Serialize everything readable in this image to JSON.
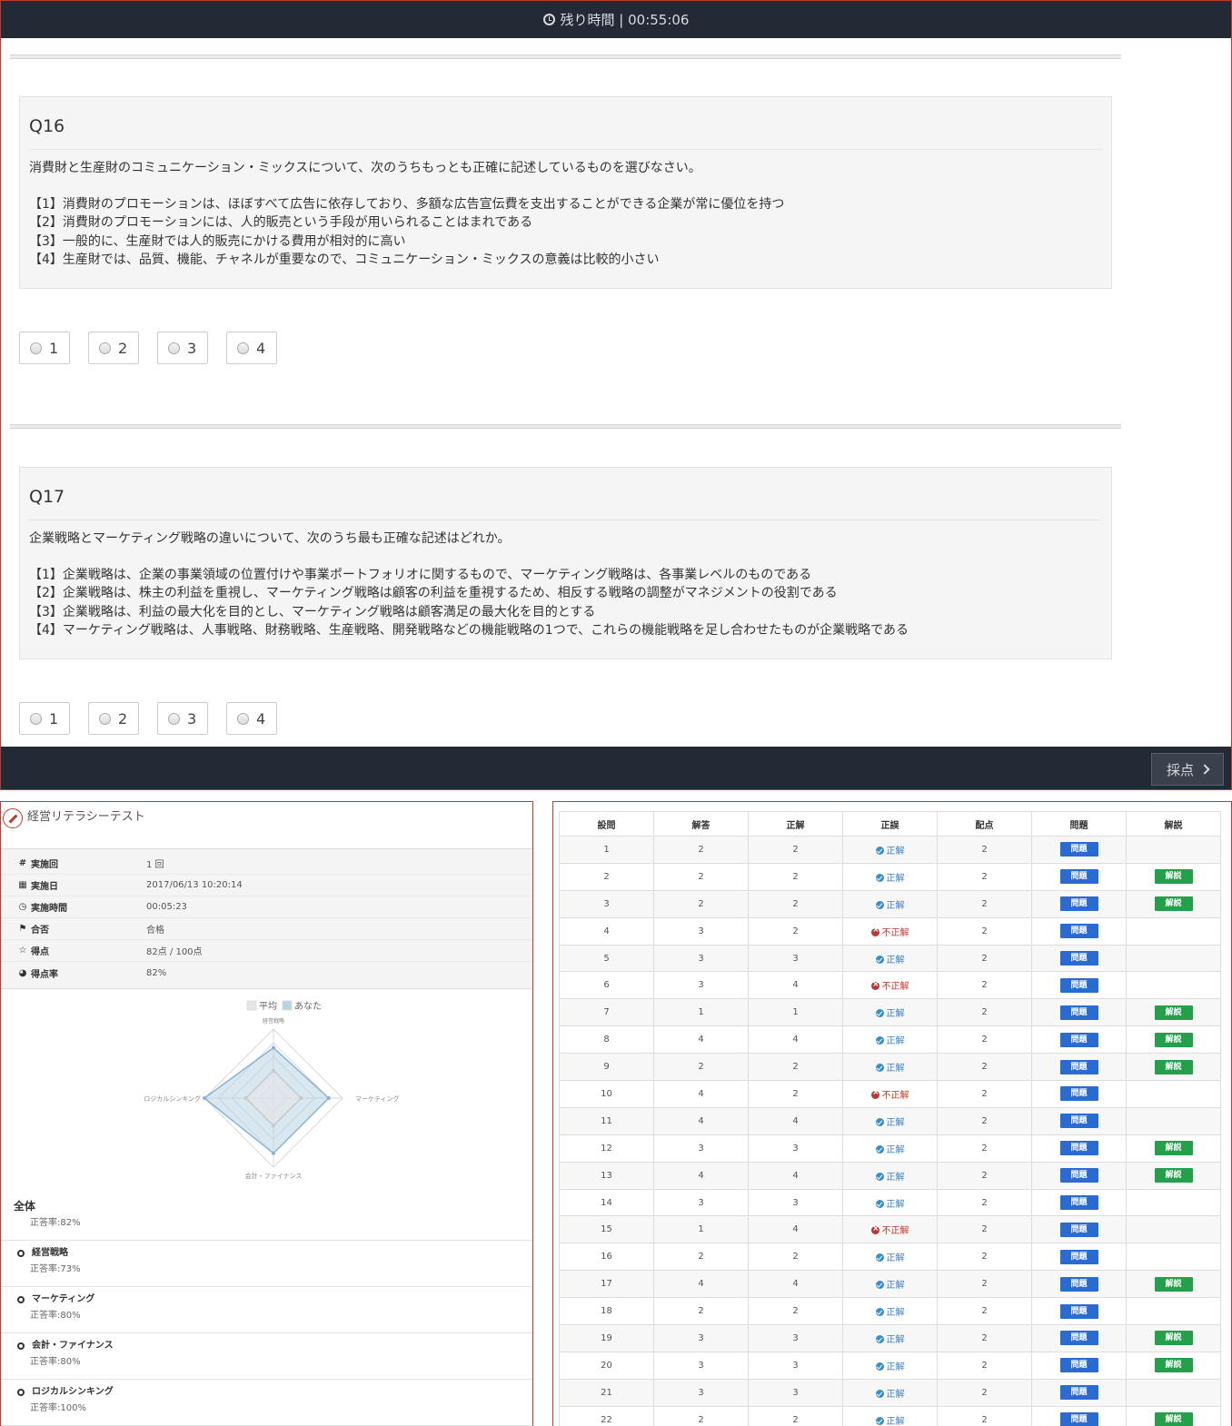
{
  "timer": {
    "label": "残り時間 | 00:55:06",
    "icon": "clock-icon"
  },
  "questions": [
    {
      "title": "Q16",
      "stem": "消費財と生産財のコミュニケーション・ミックスについて、次のうちもっとも正確に記述しているものを選びなさい。",
      "options": [
        "【1】消費財のプロモーションは、ほぼすべて広告に依存しており、多額な広告宣伝費を支出することができる企業が常に優位を持つ",
        "【2】消費財のプロモーションには、人的販売という手段が用いられることはまれである",
        "【3】一般的に、生産財では人的販売にかける費用が相対的に高い",
        "【4】生産財では、品質、機能、チャネルが重要なので、コミュニケーション・ミックスの意義は比較的小さい"
      ],
      "choices": [
        "1",
        "2",
        "3",
        "4"
      ]
    },
    {
      "title": "Q17",
      "stem": "企業戦略とマーケティング戦略の違いについて、次のうち最も正確な記述はどれか。",
      "options": [
        "【1】企業戦略は、企業の事業領域の位置付けや事業ポートフォリオに関するもので、マーケティング戦略は、各事業レベルのものである",
        "【2】企業戦略は、株主の利益を重視し、マーケティング戦略は顧客の利益を重視するため、相反する戦略の調整がマネジメントの役割である",
        "【3】企業戦略は、利益の最大化を目的とし、マーケティング戦略は顧客満足の最大化を目的とする",
        "【4】マーケティング戦略は、人事戦略、財務戦略、生産戦略、開発戦略などの機能戦略の1つで、これらの機能戦略を足し合わせたものが企業戦略である"
      ],
      "choices": [
        "1",
        "2",
        "3",
        "4"
      ]
    }
  ],
  "score_button": {
    "label": "採点",
    "icon": "chevron-right-icon"
  },
  "result": {
    "title": "経営リテラシーテスト",
    "info": [
      {
        "key": "実施回",
        "icon": "hash-icon",
        "value": "1 回"
      },
      {
        "key": "実施日",
        "icon": "calendar-icon",
        "value": "2017/06/13 10:20:14"
      },
      {
        "key": "実施時間",
        "icon": "clock-icon",
        "value": "00:05:23"
      },
      {
        "key": "合否",
        "icon": "flag-icon",
        "value": "合格"
      },
      {
        "key": "得点",
        "icon": "star-icon",
        "value": "82点 / 100点"
      },
      {
        "key": "得点率",
        "icon": "pie-icon",
        "value": "82%"
      }
    ],
    "chart_data": {
      "type": "radar",
      "axes": [
        "経営戦略",
        "マーケティング",
        "会計・ファイナンス",
        "ロジカルシンキング"
      ],
      "series": [
        {
          "name": "平均",
          "values": [
            40,
            40,
            40,
            40
          ]
        },
        {
          "name": "あなた",
          "values": [
            73,
            80,
            80,
            100
          ]
        }
      ],
      "range": [
        0,
        100
      ],
      "rings": 5,
      "colors": {
        "average": "#e6e6e6",
        "you": "#b9d3e6",
        "you_stroke": "#8ab3d3",
        "average_stroke": "#c8c8c8"
      }
    },
    "overall": {
      "name": "全体",
      "rate": "正答率:82%"
    },
    "categories": [
      {
        "name": "経営戦略",
        "rate": "正答率:73%"
      },
      {
        "name": "マーケティング",
        "rate": "正答率:80%"
      },
      {
        "name": "会計・ファイナンス",
        "rate": "正答率:80%"
      },
      {
        "name": "ロジカルシンキング",
        "rate": "正答率:100%"
      }
    ]
  },
  "answers": {
    "headers": [
      "設問",
      "解答",
      "正解",
      "正誤",
      "配点",
      "問題",
      "解説"
    ],
    "question_button": "問題",
    "explain_button": "解説",
    "status_ok": "正解",
    "status_ng": "不正解",
    "rows": [
      {
        "q": "1",
        "answer": "2",
        "correct": "2",
        "ok": true,
        "points": "2",
        "explain": false
      },
      {
        "q": "2",
        "answer": "2",
        "correct": "2",
        "ok": true,
        "points": "2",
        "explain": true
      },
      {
        "q": "3",
        "answer": "2",
        "correct": "2",
        "ok": true,
        "points": "2",
        "explain": true
      },
      {
        "q": "4",
        "answer": "3",
        "correct": "2",
        "ok": false,
        "points": "2",
        "explain": false
      },
      {
        "q": "5",
        "answer": "3",
        "correct": "3",
        "ok": true,
        "points": "2",
        "explain": false
      },
      {
        "q": "6",
        "answer": "3",
        "correct": "4",
        "ok": false,
        "points": "2",
        "explain": false
      },
      {
        "q": "7",
        "answer": "1",
        "correct": "1",
        "ok": true,
        "points": "2",
        "explain": true
      },
      {
        "q": "8",
        "answer": "4",
        "correct": "4",
        "ok": true,
        "points": "2",
        "explain": true
      },
      {
        "q": "9",
        "answer": "2",
        "correct": "2",
        "ok": true,
        "points": "2",
        "explain": true
      },
      {
        "q": "10",
        "answer": "4",
        "correct": "2",
        "ok": false,
        "points": "2",
        "explain": false
      },
      {
        "q": "11",
        "answer": "4",
        "correct": "4",
        "ok": true,
        "points": "2",
        "explain": false
      },
      {
        "q": "12",
        "answer": "3",
        "correct": "3",
        "ok": true,
        "points": "2",
        "explain": true
      },
      {
        "q": "13",
        "answer": "4",
        "correct": "4",
        "ok": true,
        "points": "2",
        "explain": true
      },
      {
        "q": "14",
        "answer": "3",
        "correct": "3",
        "ok": true,
        "points": "2",
        "explain": false
      },
      {
        "q": "15",
        "answer": "1",
        "correct": "4",
        "ok": false,
        "points": "2",
        "explain": false
      },
      {
        "q": "16",
        "answer": "2",
        "correct": "2",
        "ok": true,
        "points": "2",
        "explain": false
      },
      {
        "q": "17",
        "answer": "4",
        "correct": "4",
        "ok": true,
        "points": "2",
        "explain": true
      },
      {
        "q": "18",
        "answer": "2",
        "correct": "2",
        "ok": true,
        "points": "2",
        "explain": false
      },
      {
        "q": "19",
        "answer": "3",
        "correct": "3",
        "ok": true,
        "points": "2",
        "explain": true
      },
      {
        "q": "20",
        "answer": "3",
        "correct": "3",
        "ok": true,
        "points": "2",
        "explain": true
      },
      {
        "q": "21",
        "answer": "3",
        "correct": "3",
        "ok": true,
        "points": "2",
        "explain": false
      },
      {
        "q": "22",
        "answer": "2",
        "correct": "2",
        "ok": true,
        "points": "2",
        "explain": true
      }
    ]
  }
}
